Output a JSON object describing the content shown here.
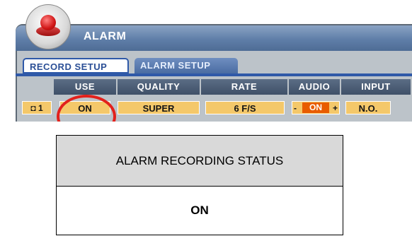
{
  "window": {
    "title": "ALARM"
  },
  "tabs": [
    {
      "label": "RECORD SETUP",
      "active": true
    },
    {
      "label": "ALARM SETUP",
      "active": false
    }
  ],
  "table": {
    "columns": [
      "USE",
      "QUALITY",
      "RATE",
      "AUDIO",
      "INPUT"
    ],
    "row": {
      "camera": "1",
      "use": "ON",
      "quality": "SUPER",
      "rate": "6 F/S",
      "audio": {
        "minus": "-",
        "value": "ON",
        "plus": "+"
      },
      "input": "N.O."
    }
  },
  "status": {
    "header": "ALARM RECORDING STATUS",
    "value": "ON"
  },
  "colors": {
    "title_bar": "#5f7ea8",
    "active_tab_border": "#2f59a8",
    "cell_fill": "#f4c86a",
    "audio_on": "#e85c00",
    "highlight_circle": "#e2211c",
    "status_header_bg": "#d9d9d9"
  },
  "icons": {
    "window": "alarm-siren-icon",
    "camera": "camera-icon",
    "highlight": "highlight-circle"
  }
}
